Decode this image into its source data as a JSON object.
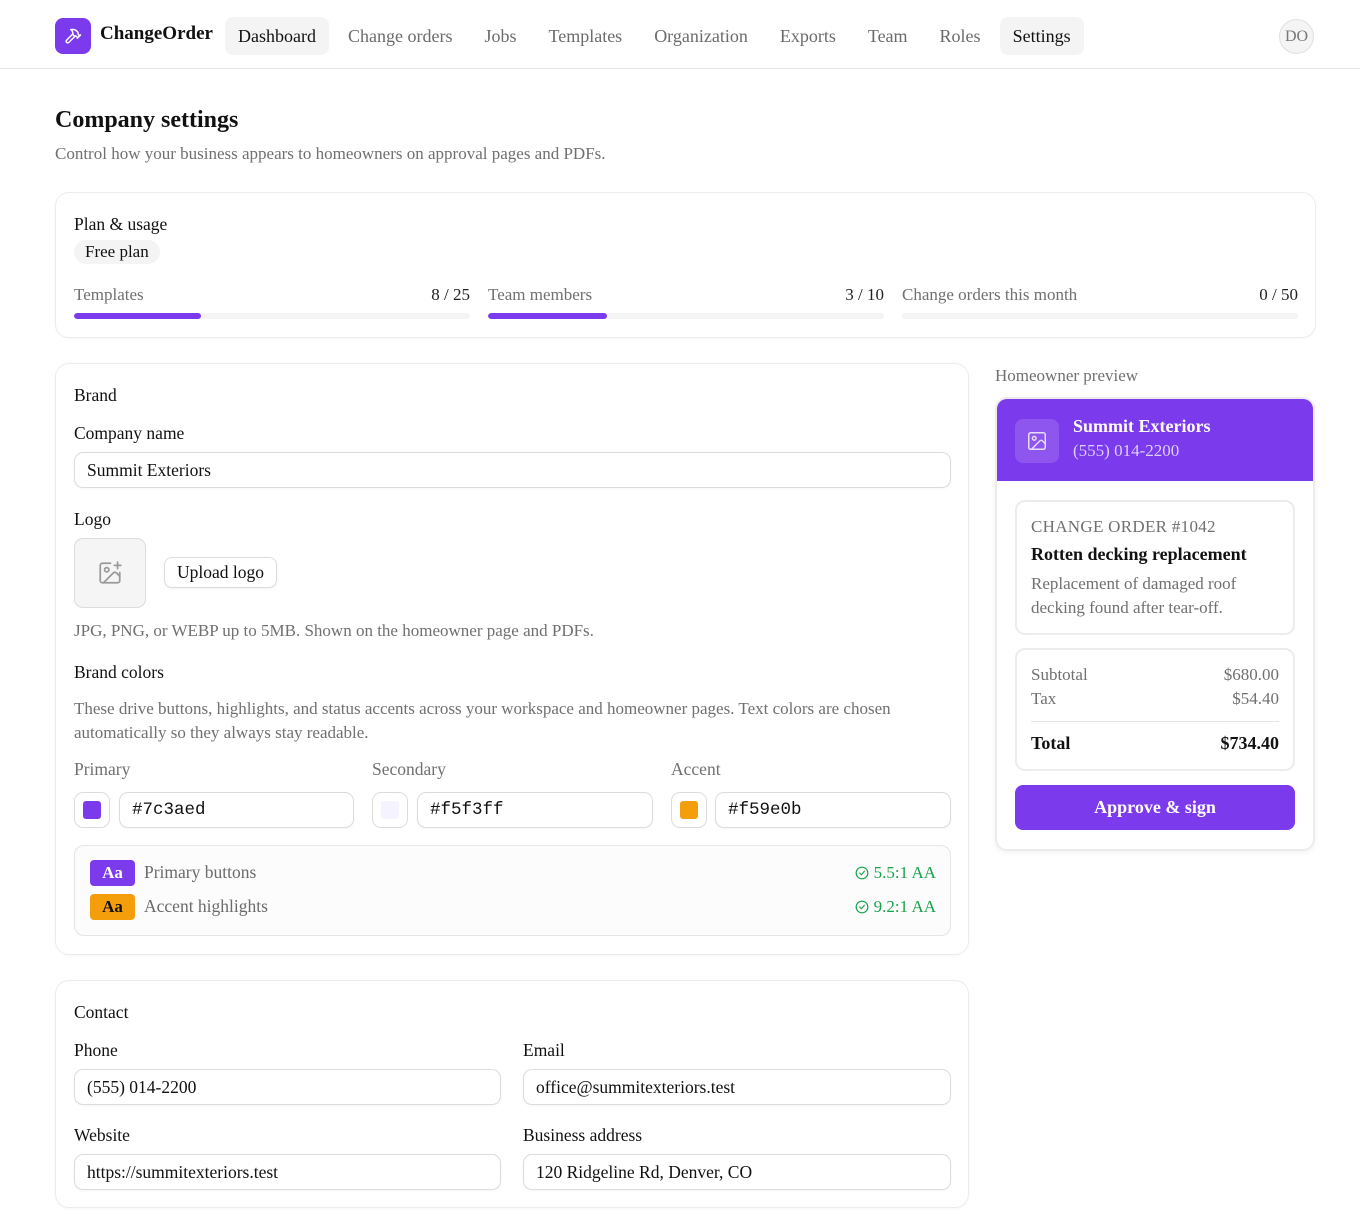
{
  "app": {
    "name": "ChangeOrder",
    "avatar_initials": "DO",
    "accent_color": "#7c3aed"
  },
  "nav": {
    "items": [
      {
        "label": "Dashboard",
        "active": true
      },
      {
        "label": "Change orders"
      },
      {
        "label": "Jobs"
      },
      {
        "label": "Templates"
      },
      {
        "label": "Organization"
      },
      {
        "label": "Exports"
      },
      {
        "label": "Team"
      },
      {
        "label": "Roles"
      },
      {
        "label": "Settings",
        "active": true
      }
    ]
  },
  "page": {
    "title": "Company settings",
    "subtitle": "Control how your business appears to homeowners on approval pages and PDFs."
  },
  "plan": {
    "title": "Plan & usage",
    "badge": "Free plan",
    "usage": [
      {
        "label": "Templates",
        "count": "8 / 25",
        "used": 8,
        "limit": 25
      },
      {
        "label": "Team members",
        "count": "3 / 10",
        "used": 3,
        "limit": 10
      },
      {
        "label": "Change orders this month",
        "count": "0 / 50",
        "used": 0,
        "limit": 50
      }
    ]
  },
  "brand": {
    "title": "Brand",
    "company_name_label": "Company name",
    "company_name_value": "Summit Exteriors",
    "logo_label": "Logo",
    "upload_label": "Upload logo",
    "logo_help": "JPG, PNG, or WEBP up to 5MB. Shown on the homeowner page and PDFs.",
    "colors_label": "Brand colors",
    "colors_help": "These drive buttons, highlights, and status accents across your workspace and homeowner pages. Text colors are chosen automatically so they always stay readable.",
    "colors": [
      {
        "label": "Primary",
        "value": "#7c3aed"
      },
      {
        "label": "Secondary",
        "value": "#f5f3ff"
      },
      {
        "label": "Accent",
        "value": "#f59e0b"
      }
    ],
    "contrast": [
      {
        "chip": "Aa",
        "label": "Primary buttons",
        "ratio": "5.5:1 AA",
        "bg": "#7c3aed",
        "fg": "#ffffff"
      },
      {
        "chip": "Aa",
        "label": "Accent highlights",
        "ratio": "9.2:1 AA",
        "bg": "#f59e0b",
        "fg": "#111111"
      }
    ]
  },
  "contact": {
    "title": "Contact",
    "phone_label": "Phone",
    "phone_value": "(555) 014-2200",
    "email_label": "Email",
    "email_value": "office@summitexteriors.test",
    "website_label": "Website",
    "website_value": "https://summitexteriors.test",
    "address_label": "Business address",
    "address_value": "120 Ridgeline Rd, Denver, CO"
  },
  "preview": {
    "label": "Homeowner preview",
    "company": "Summit Exteriors",
    "phone": "(555) 014-2200",
    "co_number": "CHANGE ORDER #1042",
    "co_title": "Rotten decking replacement",
    "co_desc": "Replacement of damaged roof decking found after tear-off.",
    "subtotal_label": "Subtotal",
    "subtotal_value": "$680.00",
    "tax_label": "Tax",
    "tax_value": "$54.40",
    "total_label": "Total",
    "total_value": "$734.40",
    "approve_label": "Approve & sign"
  }
}
